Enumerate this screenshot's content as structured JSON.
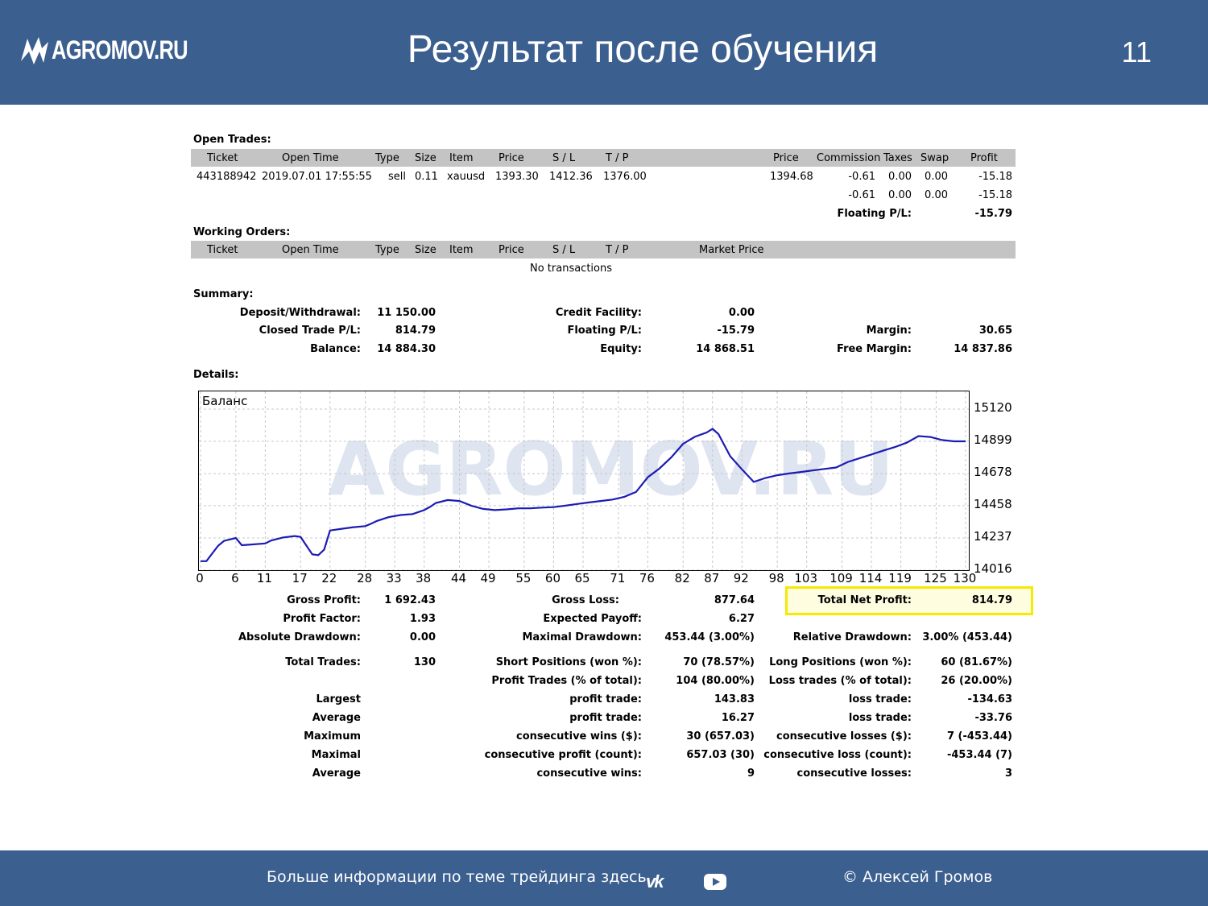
{
  "header": {
    "logo_text": "AGROMOV.RU",
    "title": "Результат после обучения",
    "slide_number": "11",
    "background_color": "#3b5f8f"
  },
  "open_trades": {
    "heading": "Open Trades:",
    "columns": [
      "Ticket",
      "Open Time",
      "Type",
      "Size",
      "Item",
      "Price",
      "S / L",
      "T / P",
      "Price",
      "Commission",
      "Taxes",
      "Swap",
      "Profit"
    ],
    "row": {
      "ticket": "443188942",
      "open_time": "2019.07.01 17:55:55",
      "type": "sell",
      "size": "0.11",
      "item": "xauusd",
      "price": "1393.30",
      "sl": "1412.36",
      "tp": "1376.00",
      "price2": "1394.68",
      "commission": "-0.61",
      "taxes": "0.00",
      "swap": "0.00",
      "profit": "-15.18"
    },
    "subtotal": {
      "commission": "-0.61",
      "taxes": "0.00",
      "swap": "0.00",
      "profit": "-15.18"
    },
    "floating_label": "Floating P/L:",
    "floating_value": "-15.79"
  },
  "working_orders": {
    "heading": "Working Orders:",
    "columns": [
      "Ticket",
      "Open Time",
      "Type",
      "Size",
      "Item",
      "Price",
      "S / L",
      "T / P",
      "Market Price"
    ],
    "empty_text": "No transactions"
  },
  "summary": {
    "heading": "Summary:",
    "deposit_label": "Deposit/Withdrawal:",
    "deposit_value": "11 150.00",
    "credit_label": "Credit Facility:",
    "credit_value": "0.00",
    "closed_label": "Closed Trade P/L:",
    "closed_value": "814.79",
    "floating_label": "Floating P/L:",
    "floating_value": "-15.79",
    "margin_label": "Margin:",
    "margin_value": "30.65",
    "balance_label": "Balance:",
    "balance_value": "14 884.30",
    "equity_label": "Equity:",
    "equity_value": "14 868.51",
    "free_margin_label": "Free Margin:",
    "free_margin_value": "14 837.86"
  },
  "details_heading": "Details:",
  "chart_data": {
    "type": "line",
    "title": "Баланс",
    "watermark": "AGROMOV.RU",
    "x_ticks": [
      "0",
      "6",
      "11",
      "17",
      "22",
      "28",
      "33",
      "38",
      "44",
      "49",
      "55",
      "60",
      "65",
      "71",
      "76",
      "82",
      "87",
      "92",
      "98",
      "103",
      "109",
      "114",
      "119",
      "125",
      "130"
    ],
    "y_ticks": [
      "15120",
      "14899",
      "14678",
      "14458",
      "14237",
      "14016"
    ],
    "ylim": [
      14016,
      15120
    ],
    "xlim": [
      0,
      130
    ],
    "grid": true,
    "series": [
      {
        "color": "#1c1cb4",
        "x": [
          0,
          1,
          3,
          4,
          6,
          7,
          8,
          11,
          12,
          14,
          16,
          17,
          19,
          20,
          21,
          22,
          24,
          26,
          28,
          29,
          30,
          32,
          34,
          36,
          38,
          39,
          40,
          42,
          44,
          46,
          48,
          50,
          52,
          54,
          56,
          58,
          60,
          62,
          64,
          66,
          68,
          70,
          72,
          74,
          76,
          78,
          80,
          82,
          84,
          86,
          87,
          88,
          90,
          92,
          94,
          96,
          98,
          100,
          102,
          104,
          106,
          108,
          110,
          112,
          114,
          116,
          118,
          120,
          122,
          124,
          126,
          128,
          130
        ],
        "y": [
          14078,
          14078,
          14184,
          14217,
          14237,
          14187,
          14190,
          14199,
          14219,
          14240,
          14250,
          14244,
          14124,
          14119,
          14157,
          14288,
          14300,
          14311,
          14318,
          14335,
          14354,
          14380,
          14394,
          14400,
          14428,
          14450,
          14477,
          14497,
          14490,
          14458,
          14436,
          14428,
          14433,
          14440,
          14440,
          14445,
          14448,
          14458,
          14470,
          14480,
          14490,
          14500,
          14519,
          14552,
          14653,
          14714,
          14790,
          14882,
          14930,
          14960,
          14985,
          14949,
          14797,
          14707,
          14621,
          14648,
          14667,
          14679,
          14689,
          14700,
          14710,
          14720,
          14758,
          14784,
          14809,
          14835,
          14860,
          14890,
          14935,
          14929,
          14908,
          14899,
          14899
        ]
      }
    ]
  },
  "results": {
    "gross_profit_label": "Gross Profit:",
    "gross_profit_value": "1 692.43",
    "gross_loss_label": "Gross Loss:",
    "gross_loss_value": "877.64",
    "total_net_label": "Total Net Profit:",
    "total_net_value": "814.79",
    "profit_factor_label": "Profit Factor:",
    "profit_factor_value": "1.93",
    "expected_payoff_label": "Expected Payoff:",
    "expected_payoff_value": "6.27",
    "abs_dd_label": "Absolute Drawdown:",
    "abs_dd_value": "0.00",
    "max_dd_label": "Maximal Drawdown:",
    "max_dd_value": "453.44 (3.00%)",
    "rel_dd_label": "Relative Drawdown:",
    "rel_dd_value": "3.00% (453.44)",
    "total_trades_label": "Total Trades:",
    "total_trades_value": "130",
    "short_label": "Short Positions (won %):",
    "short_value": "70 (78.57%)",
    "long_label": "Long Positions (won %):",
    "long_value": "60 (81.67%)",
    "profit_trades_label": "Profit Trades (% of total):",
    "profit_trades_value": "104 (80.00%)",
    "loss_trades_label": "Loss trades (% of total):",
    "loss_trades_value": "26 (20.00%)",
    "rows": [
      {
        "left": "Largest",
        "mid_label": "profit trade:",
        "mid_value": "143.83",
        "right_label": "loss trade:",
        "right_value": "-134.63"
      },
      {
        "left": "Average",
        "mid_label": "profit trade:",
        "mid_value": "16.27",
        "right_label": "loss trade:",
        "right_value": "-33.76"
      },
      {
        "left": "Maximum",
        "mid_label": "consecutive wins ($):",
        "mid_value": "30 (657.03)",
        "right_label": "consecutive losses ($):",
        "right_value": "7 (-453.44)"
      },
      {
        "left": "Maximal",
        "mid_label": "consecutive profit (count):",
        "mid_value": "657.03 (30)",
        "right_label": "consecutive loss (count):",
        "right_value": "-453.44 (7)"
      },
      {
        "left": "Average",
        "mid_label": "consecutive wins:",
        "mid_value": "9",
        "right_label": "consecutive losses:",
        "right_value": "3"
      }
    ]
  },
  "footer": {
    "info_text": "Больше информации по теме трейдинга здесь",
    "vk_icon": "vk-icon",
    "youtube_icon": "youtube-icon",
    "author": "© Алексей Громов"
  }
}
